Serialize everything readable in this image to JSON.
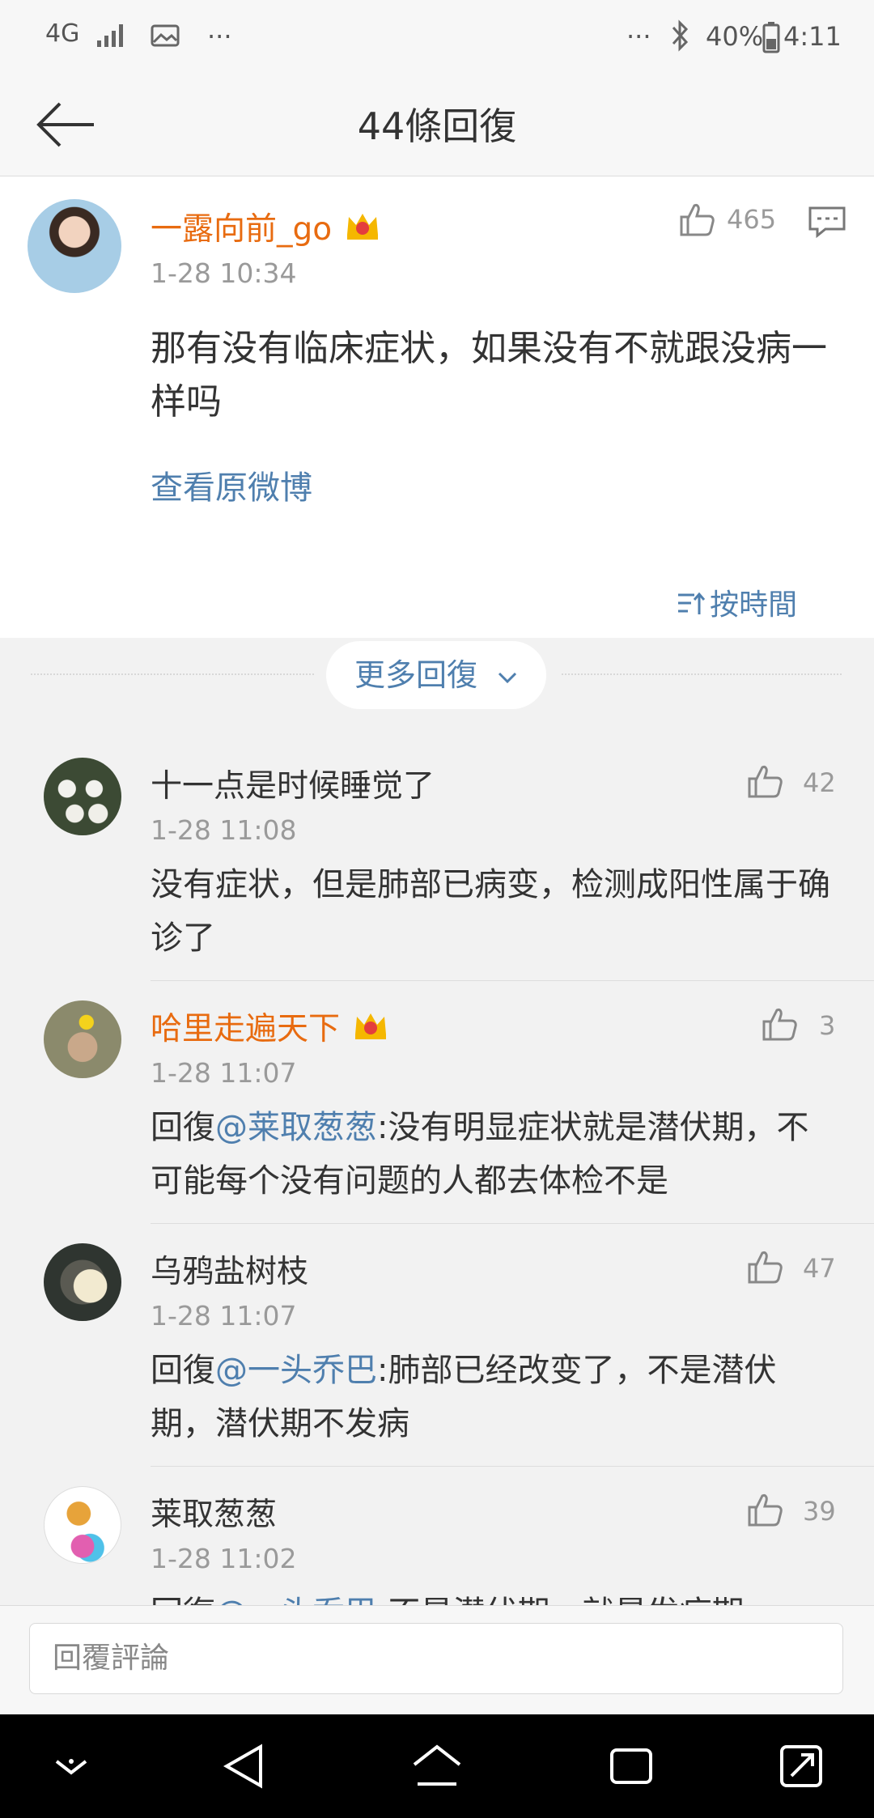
{
  "status_bar": {
    "network": "4G",
    "more_left": "···",
    "more_right": "···",
    "battery_percent": "40%",
    "time": "4:11"
  },
  "nav": {
    "title": "44條回復"
  },
  "main_comment": {
    "username": "一露向前_go",
    "time": "1-28 10:34",
    "like_count": "465",
    "text": "那有没有临床症状，如果没有不就跟没病一样吗",
    "view_original": "查看原微博",
    "sort_label": "按時間"
  },
  "more_replies": "更多回復",
  "replies": [
    {
      "username": "十一点是时候睡觉了",
      "time": "1-28 11:08",
      "likes": "42",
      "prefix": "",
      "mention": "",
      "text": "没有症状，但是肺部已病变，检测成阳性属于确诊了"
    },
    {
      "username": "哈里走遍天下",
      "time": "1-28 11:07",
      "likes": "3",
      "prefix": "回復",
      "mention": "@莱取葱葱",
      "text": ":没有明显症状就是潜伏期，不可能每个没有问题的人都去体检不是"
    },
    {
      "username": "乌鸦盐树枝",
      "time": "1-28 11:07",
      "likes": "47",
      "prefix": "回復",
      "mention": "@一头乔巴",
      "text": ":肺部已经改变了，不是潜伏期，潜伏期不发病"
    },
    {
      "username": "莱取葱葱",
      "time": "1-28 11:02",
      "likes": "39",
      "prefix": "回復",
      "mention": "@一头乔巴",
      "text": ":不是潜伏期，就是发病期"
    }
  ],
  "input": {
    "placeholder": "回覆評論"
  }
}
